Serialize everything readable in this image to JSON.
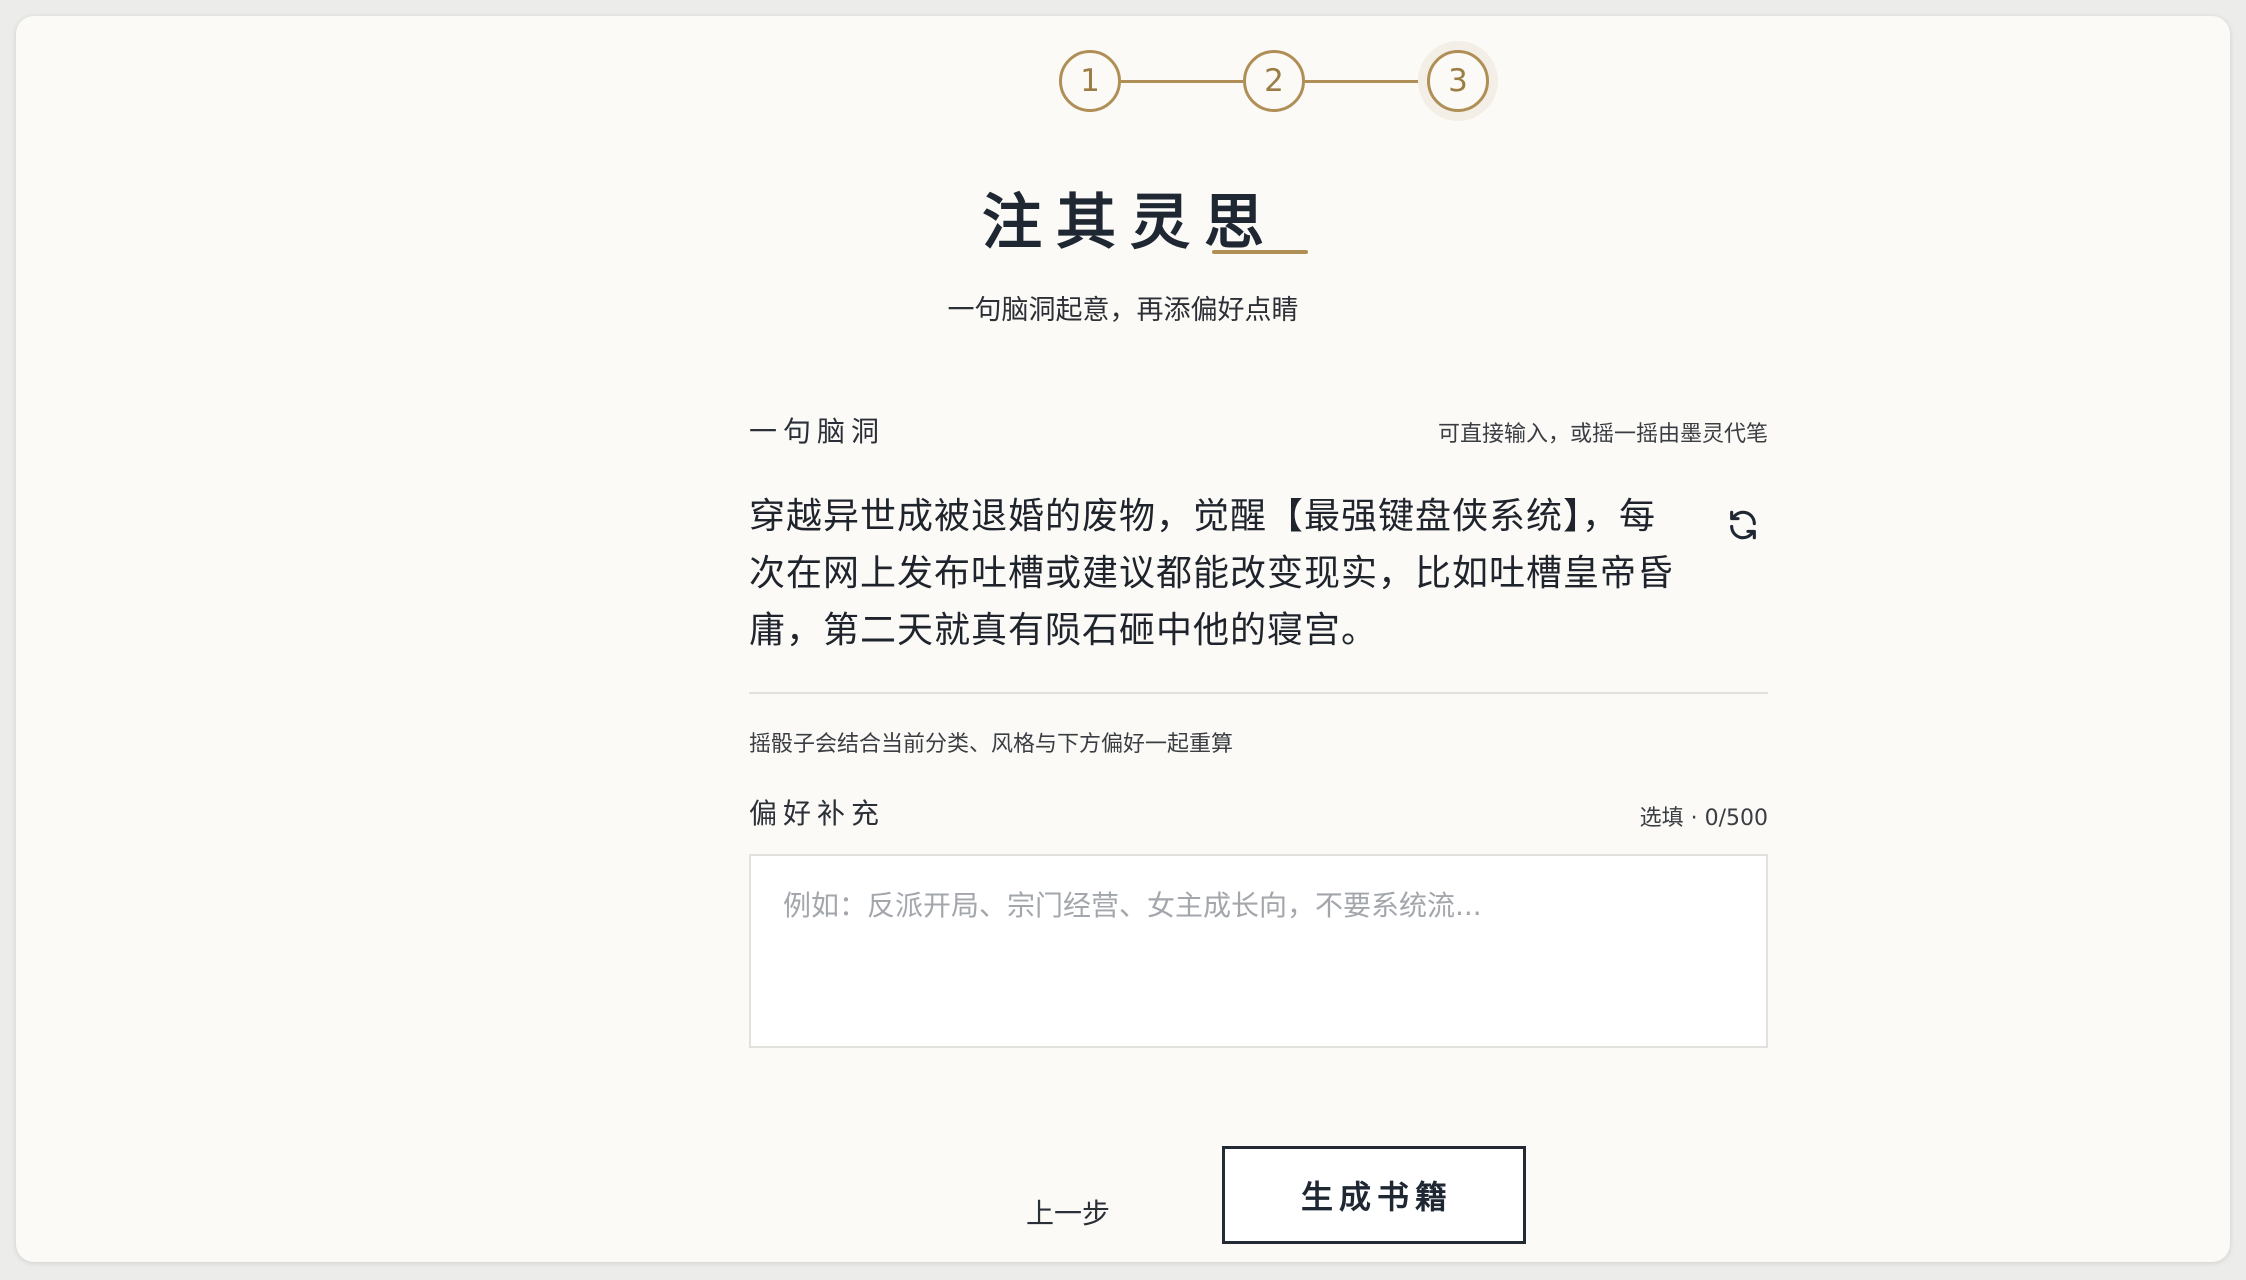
{
  "stepper": {
    "steps": [
      "1",
      "2",
      "3"
    ],
    "current": 3
  },
  "header": {
    "title": "注其灵思",
    "subtitle": "一句脑洞起意，再添偏好点睛"
  },
  "idea": {
    "label": "一句脑洞",
    "hint": "可直接输入，或摇一摇由墨灵代笔",
    "text": "穿越异世成被退婚的废物，觉醒【最强键盘侠系统】，每次在网上发布吐槽或建议都能改变现实，比如吐槽皇帝昏庸，第二天就真有陨石砸中他的寝宫。",
    "note": "摇骰子会结合当前分类、风格与下方偏好一起重算",
    "dice_icon": "refresh-icon"
  },
  "preference": {
    "label": "偏好补充",
    "count": "选填 · 0/500",
    "value": "",
    "placeholder": "例如：反派开局、宗门经营、女主成长向，不要系统流..."
  },
  "actions": {
    "back_label": "上一步",
    "generate_label": "生成书籍"
  },
  "colors": {
    "accent": "#b08f57",
    "text": "#1f2733",
    "background": "#fbfaf7"
  }
}
